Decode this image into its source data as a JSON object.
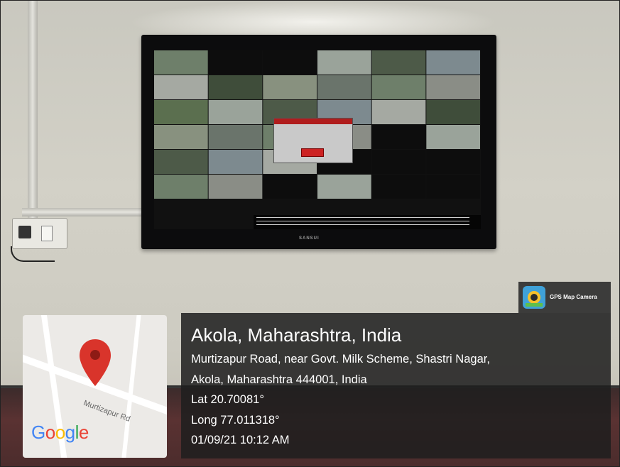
{
  "location": {
    "title": "Akola, Maharashtra, India",
    "address_line1": "Murtizapur Road, near Govt. Milk Scheme, Shastri Nagar,",
    "address_line2": "Akola, Maharashtra 444001, India",
    "lat": "Lat 20.70081°",
    "long": "Long 77.011318°",
    "datetime": "01/09/21 10:12 AM"
  },
  "map": {
    "road_label": "Murtizapur Rd",
    "brand": "Google",
    "pin_color": "#d9342b",
    "icon": "map-pin-icon"
  },
  "badge": {
    "label": "GPS Map Camera",
    "icon": "gps-map-camera-icon"
  },
  "tv": {
    "brand": "SANSUI"
  },
  "colors": {
    "overlay": "#1e1e1e",
    "text": "#ffffff",
    "google_blue": "#4285F4",
    "google_red": "#EA4335",
    "google_yellow": "#FBBC05",
    "google_green": "#34A853"
  }
}
